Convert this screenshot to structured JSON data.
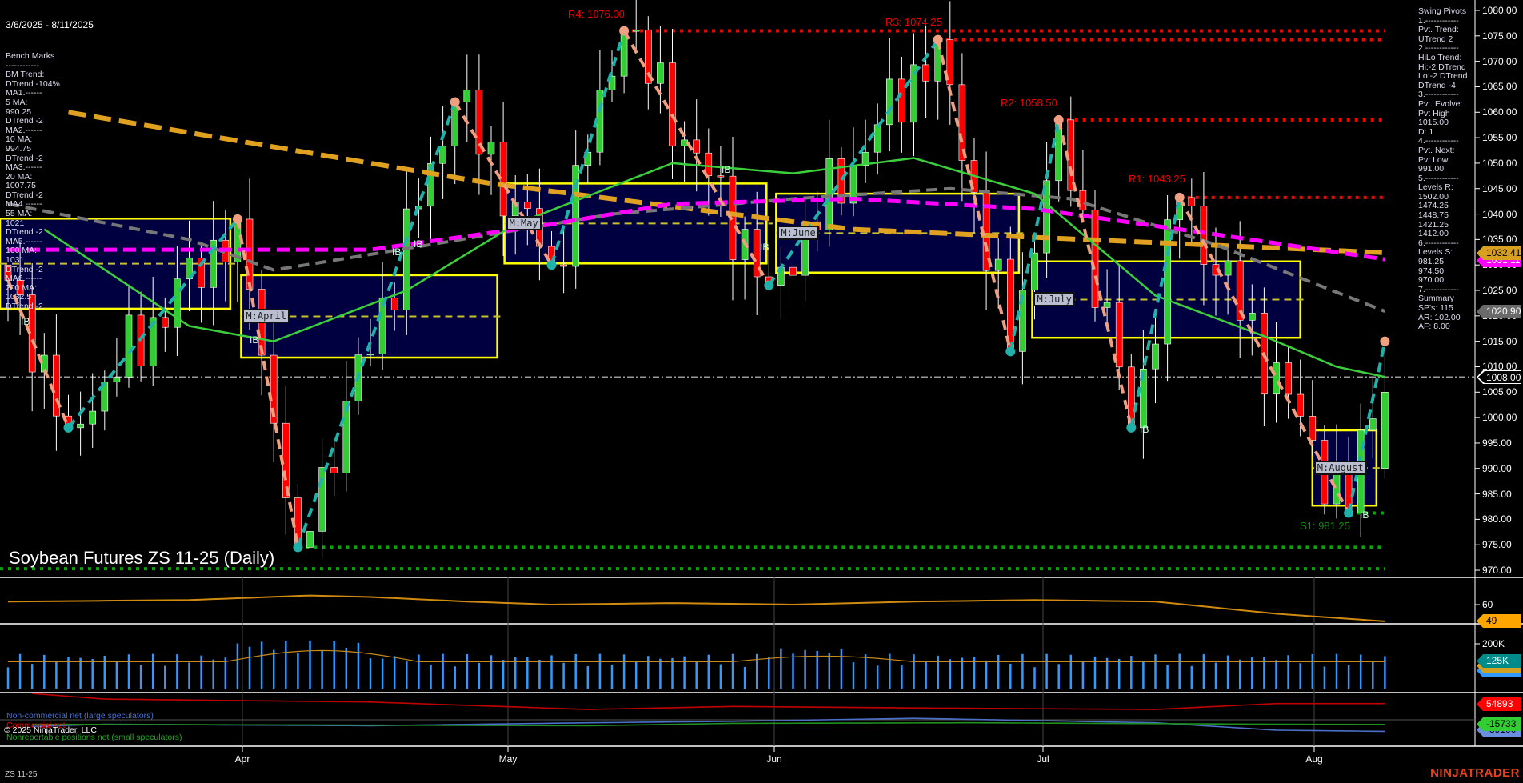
{
  "header": {
    "date_range": "3/6/2025 - 8/11/2025"
  },
  "title": "Soybean Futures ZS 11-25 (Daily)",
  "instrument_label": "ZS 11-25",
  "brand": "NINJATRADER",
  "copyright": "© 2025 NinjaTrader, LLC",
  "left_panel": [
    "Bench Marks",
    "------------",
    "BM Trend:",
    "DTrend -104%",
    "MA1.------",
    "5 MA:",
    "990.25",
    "DTrend -2",
    "MA2.------",
    "10 MA:",
    "994.75",
    "DTrend -2",
    "MA3.------",
    "20 MA:",
    "1007.75",
    "DTrend -2",
    "MA4.------",
    "55 MA:",
    "1021",
    "DTrend -2",
    "MA5.------",
    "100 MA:",
    "1031",
    "DTrend -2",
    "MA6.------",
    "200 MA:",
    "1032.5",
    "DTrend -2"
  ],
  "right_panel": [
    "Swing Pivots",
    "1.------------",
    "Pvt. Trend:",
    "UTrend 2",
    "2.------------",
    "HiLo Trend:",
    "Hi:-2 DTrend",
    "Lo:-2 DTrend",
    "DTrend -4",
    "3.------------",
    "Pvt. Evolve:",
    "Pvt High",
    "1015.00",
    "D: 1",
    "4.------------",
    "Pvt. Next:",
    "Pvt Low",
    "991.00",
    "5.------------",
    "Levels R:",
    "1502.00",
    "1474.25",
    "1448.75",
    "1421.25",
    "1412.00",
    "6.------------",
    "Levels S:",
    "981.25",
    "974.50",
    "970.00",
    "7.------------",
    "Summary",
    "SP's: 115",
    "AR: 102.00",
    "AF: 8.00"
  ],
  "levels": {
    "r4": {
      "label": "R4: 1076.00",
      "price": 1076.0,
      "bar": 51
    },
    "r3": {
      "label": "R3: 1074.25",
      "price": 1074.25,
      "bar": 77
    },
    "r2": {
      "label": "R2: 1058.50",
      "price": 1058.5,
      "bar": 87
    },
    "r1": {
      "label": "R1: 1043.25",
      "price": 1043.25,
      "bar": 97
    },
    "s1": {
      "label": "S1: 981.25",
      "price": 981.25,
      "bar": 111
    }
  },
  "price_axis": {
    "ticks": [
      "1080.00",
      "1075.00",
      "1070.00",
      "1065.00",
      "1060.00",
      "1055.00",
      "1050.00",
      "1045.00",
      "1040.00",
      "1035.00",
      "1030.00",
      "1025.00",
      "1020.00",
      "1015.00",
      "1010.00",
      "1005.00",
      "1000.00",
      "995.00",
      "990.00",
      "985.00",
      "980.00",
      "975.00",
      "970.00"
    ]
  },
  "flags": {
    "ma200": "1032.41",
    "ma100": "1031.11",
    "ma55": "1020.90",
    "last": "1008.00",
    "osc": "49",
    "volume": "125K",
    "commercial": "54893",
    "small_spec": "-15733",
    "large_spec": "-39100"
  },
  "osc_axis": {
    "tick": "60"
  },
  "volume_axis": {
    "tick": "200K"
  },
  "months": [
    "Apr",
    "May",
    "Jun",
    "Jul",
    "Aug"
  ],
  "month_boxes": [
    {
      "label": "",
      "hi": 1039.1,
      "lo": 1021.4,
      "from": -1,
      "to": 18.4
    },
    {
      "label": "M:April",
      "hi": 1028,
      "lo": 1011.8,
      "from": 19.3,
      "to": 40.5
    },
    {
      "label": "M:May",
      "hi": 1046,
      "lo": 1030.3,
      "from": 41.1,
      "to": 62.8
    },
    {
      "label": "M:June",
      "hi": 1044,
      "lo": 1028.5,
      "from": 63.6,
      "to": 83.7
    },
    {
      "label": "M:July",
      "hi": 1030.7,
      "lo": 1015.7,
      "from": 84.8,
      "to": 107
    },
    {
      "label": "M:August",
      "hi": 997.5,
      "lo": 982.7,
      "from": 108,
      "to": 113.3
    }
  ],
  "markers": {
    "ib_label": "IB"
  },
  "cot_legend": {
    "large": "Non-commercial net (large speculators)",
    "commercial": "Commercial net",
    "small": "Nonreportable positions net (small speculators)"
  },
  "colors": {
    "up": "#32cd32",
    "down": "#ff0000",
    "box_fill": "#000040",
    "box_edge": "#ffff00",
    "zig_up": "#20b2aa",
    "zig_down": "#f0a080",
    "ma20": "#3ccf3c",
    "ma55": "#777777",
    "ma100": "#ff00ff",
    "ma200": "#e0a020",
    "brand": "#e8401c"
  },
  "chart_data": {
    "type": "candlestick",
    "title": "Soybean Futures ZS 11-25 (Daily)",
    "bars": 115,
    "ylim": [
      968,
      1082
    ],
    "swing_pivots": [
      [
        0,
        1027
      ],
      [
        5,
        998
      ],
      [
        19,
        1039
      ],
      [
        24,
        974.5
      ],
      [
        37,
        1062
      ],
      [
        45,
        1030
      ],
      [
        51,
        1076
      ],
      [
        63,
        1026
      ],
      [
        77,
        1074.25
      ],
      [
        83,
        1013
      ],
      [
        87,
        1058.5
      ],
      [
        93,
        998
      ],
      [
        97,
        1043.25
      ],
      [
        111,
        981.25
      ],
      [
        114,
        1015
      ]
    ],
    "last_bar": {
      "open": 990,
      "high": 1015,
      "low": 988,
      "close": 1005
    },
    "ma200": [
      [
        5,
        1060
      ],
      [
        40,
        1046
      ],
      [
        70,
        1037
      ],
      [
        114,
        1032.41
      ]
    ],
    "ma100": [
      [
        0,
        1033
      ],
      [
        19,
        1033
      ],
      [
        30,
        1033
      ],
      [
        45,
        1038
      ],
      [
        55,
        1042
      ],
      [
        70,
        1043
      ],
      [
        85,
        1041
      ],
      [
        100,
        1036
      ],
      [
        114,
        1031.11
      ]
    ],
    "ma55": [
      [
        0,
        1042
      ],
      [
        15,
        1035
      ],
      [
        22,
        1029
      ],
      [
        35,
        1034
      ],
      [
        50,
        1040
      ],
      [
        65,
        1043
      ],
      [
        78,
        1045
      ],
      [
        88,
        1043
      ],
      [
        100,
        1034
      ],
      [
        114,
        1020.9
      ]
    ],
    "ma20": [
      [
        3,
        1037
      ],
      [
        15,
        1018
      ],
      [
        22,
        1015
      ],
      [
        33,
        1025
      ],
      [
        42,
        1038
      ],
      [
        55,
        1050
      ],
      [
        65,
        1048
      ],
      [
        75,
        1051
      ],
      [
        85,
        1044
      ],
      [
        95,
        1024
      ],
      [
        104,
        1016
      ],
      [
        110,
        1010
      ],
      [
        114,
        1008
      ]
    ],
    "oscillator": [
      [
        0,
        62
      ],
      [
        15,
        63
      ],
      [
        25,
        66
      ],
      [
        30,
        65
      ],
      [
        38,
        62
      ],
      [
        45,
        60
      ],
      [
        55,
        61
      ],
      [
        65,
        60
      ],
      [
        75,
        62
      ],
      [
        85,
        63
      ],
      [
        95,
        62
      ],
      [
        105,
        54
      ],
      [
        114,
        49
      ]
    ],
    "volume_avg_k": 125,
    "cot": {
      "commercial": [
        [
          0,
          95
        ],
        [
          8,
          70
        ],
        [
          30,
          60
        ],
        [
          48,
          35
        ],
        [
          60,
          45
        ],
        [
          75,
          40
        ],
        [
          95,
          35
        ],
        [
          105,
          55
        ],
        [
          114,
          54.893
        ]
      ],
      "large_spec": [
        [
          0,
          -25
        ],
        [
          8,
          -15
        ],
        [
          30,
          -20
        ],
        [
          48,
          -10
        ],
        [
          60,
          -5
        ],
        [
          75,
          5
        ],
        [
          95,
          -10
        ],
        [
          105,
          -35
        ],
        [
          114,
          -39.1
        ]
      ],
      "small_spec": [
        [
          0,
          -15
        ],
        [
          30,
          -18
        ],
        [
          48,
          -20
        ],
        [
          60,
          -12
        ],
        [
          80,
          -10
        ],
        [
          105,
          -15
        ],
        [
          114,
          -15.733
        ]
      ]
    }
  }
}
